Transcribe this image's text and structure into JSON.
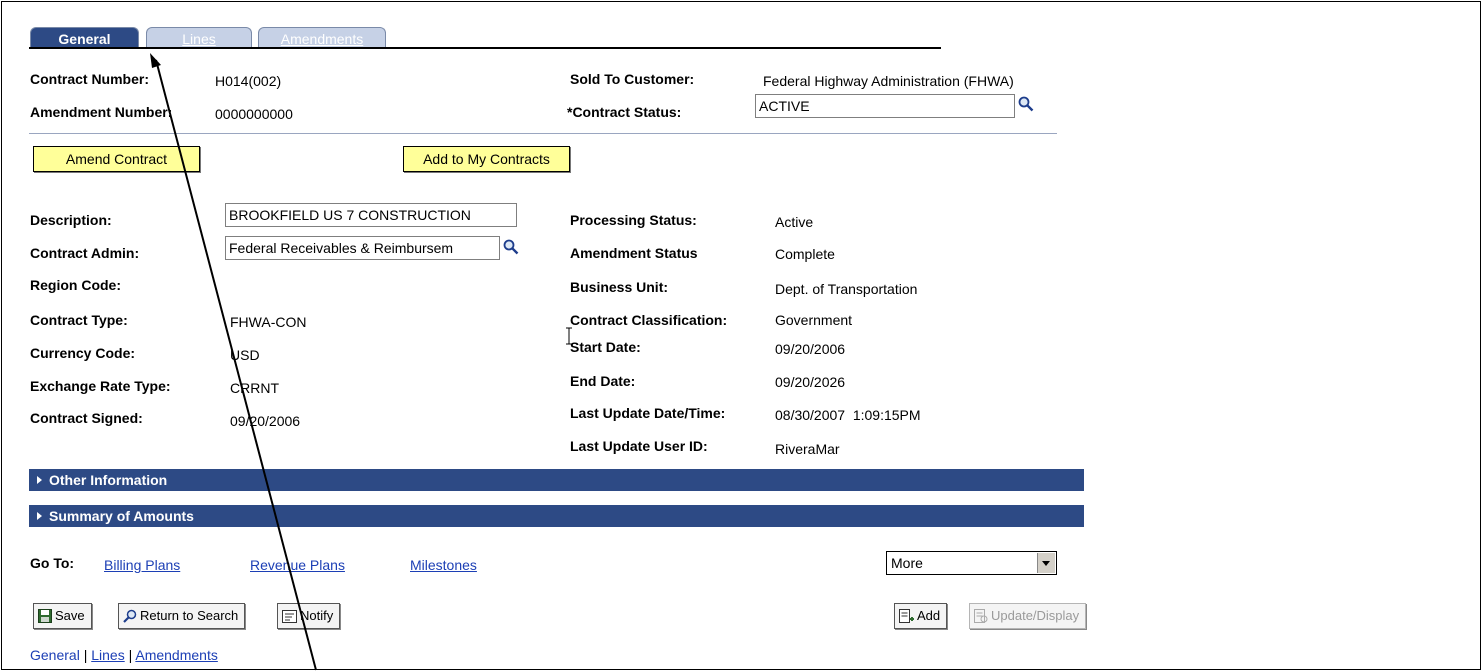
{
  "tabs": [
    {
      "label": "General"
    },
    {
      "label": "Lines"
    },
    {
      "label": "Amendments"
    }
  ],
  "header": {
    "contract_number_label": "Contract Number:",
    "contract_number_value": "H014(002)",
    "amendment_number_label": "Amendment Number:",
    "amendment_number_value": "0000000000",
    "sold_to_label": "Sold To Customer:",
    "sold_to_value": "Federal Highway Administration (FHWA)",
    "contract_status_label": "*Contract Status:",
    "contract_status_value": "ACTIVE"
  },
  "buttons": {
    "amend_contract": "Amend Contract",
    "add_to_my_contracts": "Add to My Contracts"
  },
  "left_fields": {
    "description_label": "Description:",
    "description_value": "BROOKFIELD US 7 CONSTRUCTION",
    "contract_admin_label": "Contract Admin:",
    "contract_admin_value": "Federal Receivables & Reimbursem",
    "region_code_label": "Region Code:",
    "contract_type_label": "Contract Type:",
    "contract_type_value": "FHWA-CON",
    "currency_code_label": "Currency Code:",
    "currency_code_value": "USD",
    "exchange_rate_label": "Exchange Rate Type:",
    "exchange_rate_value": "CRRNT",
    "contract_signed_label": "Contract Signed:",
    "contract_signed_value": "09/20/2006"
  },
  "right_fields": {
    "processing_status_label": "Processing Status:",
    "processing_status_value": "Active",
    "amendment_status_label": "Amendment Status",
    "amendment_status_value": "Complete",
    "business_unit_label": "Business Unit:",
    "business_unit_value": "Dept. of Transportation",
    "classification_label": "Contract Classification:",
    "classification_value": "Government",
    "start_date_label": "Start Date:",
    "start_date_value": "09/20/2006",
    "end_date_label": "End Date:",
    "end_date_value": "09/20/2026",
    "last_update_label": "Last Update Date/Time:",
    "last_update_value": "08/30/2007  1:09:15PM",
    "last_user_label": "Last Update User ID:",
    "last_user_value": "RiveraMar"
  },
  "sections": {
    "other_information": "Other Information",
    "summary_of_amounts": "Summary of Amounts"
  },
  "goto": {
    "label": "Go To:",
    "billing_plans": "Billing Plans",
    "revenue_plans": "Revenue Plans",
    "milestones": "Milestones",
    "more_selected": "More"
  },
  "toolbar": {
    "save": "Save",
    "return_to_search": "Return to Search",
    "notify": "Notify",
    "add": "Add",
    "update_display": "Update/Display"
  },
  "footer_links": {
    "general": "General",
    "sep1": "|",
    "lines": "Lines",
    "sep2": "|",
    "amendments": "Amendments"
  },
  "colors": {
    "tab_active": "#2d4a85",
    "tab_inactive": "#c6d1e6",
    "section_bar": "#2d4a85",
    "button_yellow": "#ffff99",
    "link": "#1c3fb5"
  }
}
